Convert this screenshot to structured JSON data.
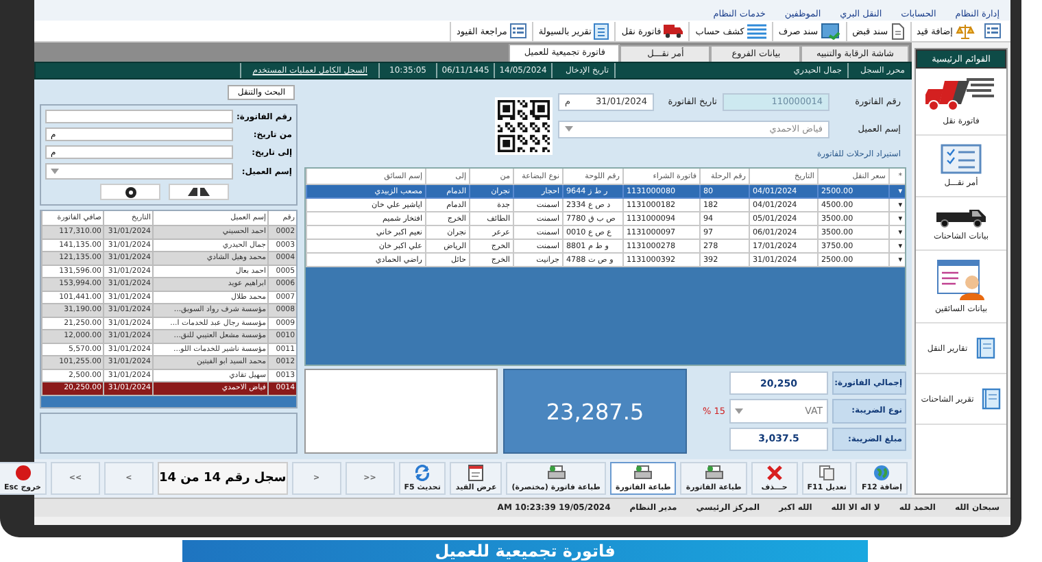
{
  "menu_bar": [
    "إدارة النظام",
    "الحسابات",
    "النقل البري",
    "الموظفين",
    "خدمات النظام"
  ],
  "toolbar": [
    {
      "kind": "list"
    },
    {
      "kind": "scale",
      "label": "إضافة قيد"
    },
    {
      "kind": "doc",
      "label": "سند قبض"
    },
    {
      "kind": "picture",
      "label": "سند صرف"
    },
    {
      "kind": "lines",
      "label": "كشف حساب"
    },
    {
      "kind": "truck",
      "label": "فاتورة نقل"
    },
    {
      "kind": "report",
      "label": "تقرير بالسيولة"
    },
    {
      "kind": "list",
      "label": "مراجعة القيود"
    }
  ],
  "tabs": [
    {
      "label": "شاشة الرقابة والتنبيه",
      "selected": false
    },
    {
      "label": "بيانات الفروع",
      "selected": false
    },
    {
      "label": "أمر نقـــل",
      "selected": false
    },
    {
      "label": "فاتورة تجميعية للعميل",
      "selected": true
    }
  ],
  "record_bar": [
    {
      "kind": "label",
      "text": "محرر السجل"
    },
    {
      "kind": "wide",
      "text": "جمال الحيدري"
    },
    {
      "kind": "label",
      "text": "تاريخ الإدخال"
    },
    {
      "kind": "value",
      "text": "14/05/2024"
    },
    {
      "kind": "value",
      "text": "06/11/1445"
    },
    {
      "kind": "value",
      "text": "10:35:05"
    },
    {
      "kind": "link",
      "text": "السجل الكامل لعمليات المستخدم"
    }
  ],
  "sidebar": {
    "title": "القوائم الرئيسية",
    "items": [
      {
        "kind": "truck",
        "label": "فاتورة نقل"
      },
      {
        "kind": "checklist",
        "label": "أمر نقـــل"
      },
      {
        "kind": "trucks",
        "label": "بيانات الشاحنات"
      },
      {
        "kind": "drivers",
        "label": "بيانات السائقين"
      },
      {
        "kind": "book",
        "label": "تقارير النقل"
      },
      {
        "kind": "book",
        "label": "تقرير الشاحنات"
      }
    ]
  },
  "invoice": {
    "number_label": "رقم الفاتورة",
    "number": "110000014",
    "date_label": "تاريخ الفاتورة",
    "date": "31/01/2024",
    "date_suffix": "م",
    "customer_label": "إسم العميل",
    "customer": "فياض الاحمدي",
    "import_label": "استيراد الرحلات للفاتورة"
  },
  "trips": {
    "columns": [
      "*",
      "سعر النقل",
      "التاريخ",
      "رقم الرحلة",
      "فاتورة الشراء",
      "رقم اللوحة",
      "نوع البضاعة",
      "من",
      "إلى",
      "إسم السائق"
    ],
    "rows": [
      {
        "selected": true,
        "cells": [
          "▾",
          "2500.00",
          "04/01/2024",
          "80",
          "1131000080",
          "9644 ر ط ز",
          "احجار",
          "نجران",
          "الدمام",
          "مصعب الزبيدي"
        ]
      },
      {
        "selected": false,
        "cells": [
          "▾",
          "4500.00",
          "04/01/2024",
          "182",
          "1131000182",
          "2334 د ص ع",
          "اسمنت",
          "جدة",
          "الدمام",
          "اياشير علي خان"
        ]
      },
      {
        "selected": false,
        "cells": [
          "▾",
          "3500.00",
          "05/01/2024",
          "94",
          "1131000094",
          "7780 ص ب ق",
          "اسمنت",
          "الطائف",
          "الخرج",
          "افتخار شميم"
        ]
      },
      {
        "selected": false,
        "cells": [
          "▾",
          "3500.00",
          "06/01/2024",
          "97",
          "1131000097",
          "0010 ع ص ع",
          "اسمنت",
          "عرعر",
          "نجران",
          "نعيم اكبر خاني"
        ]
      },
      {
        "selected": false,
        "cells": [
          "▾",
          "3750.00",
          "17/01/2024",
          "278",
          "1131000278",
          "8801 و ط م",
          "اسمنت",
          "الخرج",
          "الرياض",
          "علي اكبر خان"
        ]
      },
      {
        "selected": false,
        "cells": [
          "▾",
          "2500.00",
          "31/01/2024",
          "392",
          "1131000392",
          "4788 و ص ت",
          "جرانيت",
          "الخرج",
          "حائل",
          "راضي الحمادي"
        ]
      }
    ]
  },
  "search": {
    "tab": "البحث والتنقل",
    "fields": [
      {
        "kind": "text",
        "label": "رقم الفاتورة:"
      },
      {
        "kind": "date",
        "label": "من تاريخ:",
        "suffix": "م"
      },
      {
        "kind": "date",
        "label": "إلى تاريخ:",
        "suffix": "م"
      },
      {
        "kind": "dropdown",
        "label": "إسم العميل:"
      }
    ]
  },
  "invoice_list": {
    "columns": [
      "رقم",
      "إسم العميل",
      "التاريخ",
      "صافي الفاتورة"
    ],
    "rows": [
      {
        "selected": false,
        "cells": [
          "0002",
          "احمد الحسيني",
          "31/01/2024",
          "117,310.00"
        ]
      },
      {
        "selected": false,
        "cells": [
          "0003",
          "جمال الحيدري",
          "31/01/2024",
          "141,135.00"
        ]
      },
      {
        "selected": false,
        "cells": [
          "0004",
          "محمد وهيل الشادي",
          "31/01/2024",
          "121,135.00"
        ]
      },
      {
        "selected": false,
        "cells": [
          "0005",
          "احمد بعال",
          "31/01/2024",
          "131,596.00"
        ]
      },
      {
        "selected": false,
        "cells": [
          "0006",
          "ابراهيم عويد",
          "31/01/2024",
          "153,994.00"
        ]
      },
      {
        "selected": false,
        "cells": [
          "0007",
          "محمد طلال",
          "31/01/2024",
          "101,441.00"
        ]
      },
      {
        "selected": false,
        "cells": [
          "0008",
          "مؤسسة شرف رواد السويق...",
          "31/01/2024",
          "31,190.00"
        ]
      },
      {
        "selected": false,
        "cells": [
          "0009",
          "مؤسسة رجال عبد للخدمات ا...",
          "31/01/2024",
          "21,250.00"
        ]
      },
      {
        "selected": false,
        "cells": [
          "0010",
          "مؤسسة مشعل العتيبي للنق...",
          "31/01/2024",
          "12,000.00"
        ]
      },
      {
        "selected": false,
        "cells": [
          "0011",
          "مؤسسة ناشير للخدمات اللو...",
          "31/01/2024",
          "5,570.00"
        ]
      },
      {
        "selected": false,
        "cells": [
          "0012",
          "محمد السيد ابو الفيتين",
          "31/01/2024",
          "101,255.00"
        ]
      },
      {
        "selected": false,
        "cells": [
          "0013",
          "سهيل تقادي",
          "31/01/2024",
          "2,500.00"
        ]
      },
      {
        "selected": true,
        "cells": [
          "0014",
          "فياض الاحمدي",
          "31/01/2024",
          "20,250.00"
        ]
      }
    ]
  },
  "totals": {
    "total_label": "إجمالي الفاتورة:",
    "total": "20,250",
    "tax_type_label": "نوع الضريبة:",
    "tax_type": "VAT",
    "tax_rate": "15 %",
    "tax_amount_label": "مبلغ الضريبة:",
    "tax_amount": "3,037.5",
    "grand_total": "23,287.5"
  },
  "actions": [
    {
      "kind": "globe",
      "label": "إضافة F12",
      "focused": false
    },
    {
      "kind": "copy",
      "label": "تعديل F11",
      "focused": false
    },
    {
      "kind": "cross",
      "label": "حـــذف",
      "focused": false
    },
    {
      "kind": "printer",
      "label": "طباعة الفاتورة",
      "focused": false
    },
    {
      "kind": "printer",
      "label": "طباعة الفاتورة",
      "focused": true
    },
    {
      "kind": "printer",
      "label": "طباعة فاتورة (مختصرة)",
      "focused": false
    },
    {
      "kind": "note",
      "label": "عرض القيد",
      "focused": false
    },
    {
      "kind": "refresh",
      "label": "تحديث F5",
      "focused": false
    },
    {
      "kind": "nav",
      "label": ">>",
      "focused": false
    },
    {
      "kind": "nav",
      "label": ">",
      "focused": false
    },
    {
      "kind": "position",
      "label": "سجل رقم 14 من 14",
      "focused": false
    },
    {
      "kind": "nav",
      "label": "<",
      "focused": false
    },
    {
      "kind": "nav",
      "label": "<<",
      "focused": false
    },
    {
      "kind": "dot",
      "label": "خروج Esc",
      "focused": false
    }
  ],
  "status_bar": [
    "سبحان الله",
    "الحمد لله",
    "لا اله الا الله",
    "الله اكبر",
    "المركز الرئيسي",
    "مدير النظام",
    "19/05/2024 10:23:39 AM"
  ],
  "banner": "فاتورة تجميعية للعميل"
}
